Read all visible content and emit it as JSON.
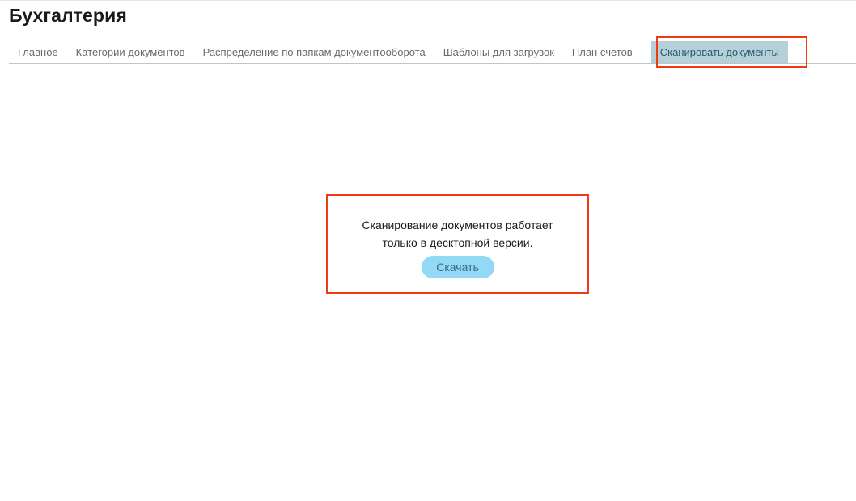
{
  "header": {
    "title": "Бухгалтерия"
  },
  "tabs": [
    {
      "label": "Главное",
      "active": false
    },
    {
      "label": "Категории документов",
      "active": false
    },
    {
      "label": "Распределение по папкам документооборота",
      "active": false
    },
    {
      "label": "Шаблоны для загрузок",
      "active": false
    },
    {
      "label": "План счетов",
      "active": false
    },
    {
      "label": "Сканировать документы",
      "active": true
    }
  ],
  "notice": {
    "line1": "Сканирование документов работает",
    "line2": "только в десктопной версии.",
    "button_label": "Скачать"
  },
  "colors": {
    "highlight": "#f03a17",
    "active_tab_bg": "#b7d0d8",
    "button_bg": "#92d9f5"
  }
}
